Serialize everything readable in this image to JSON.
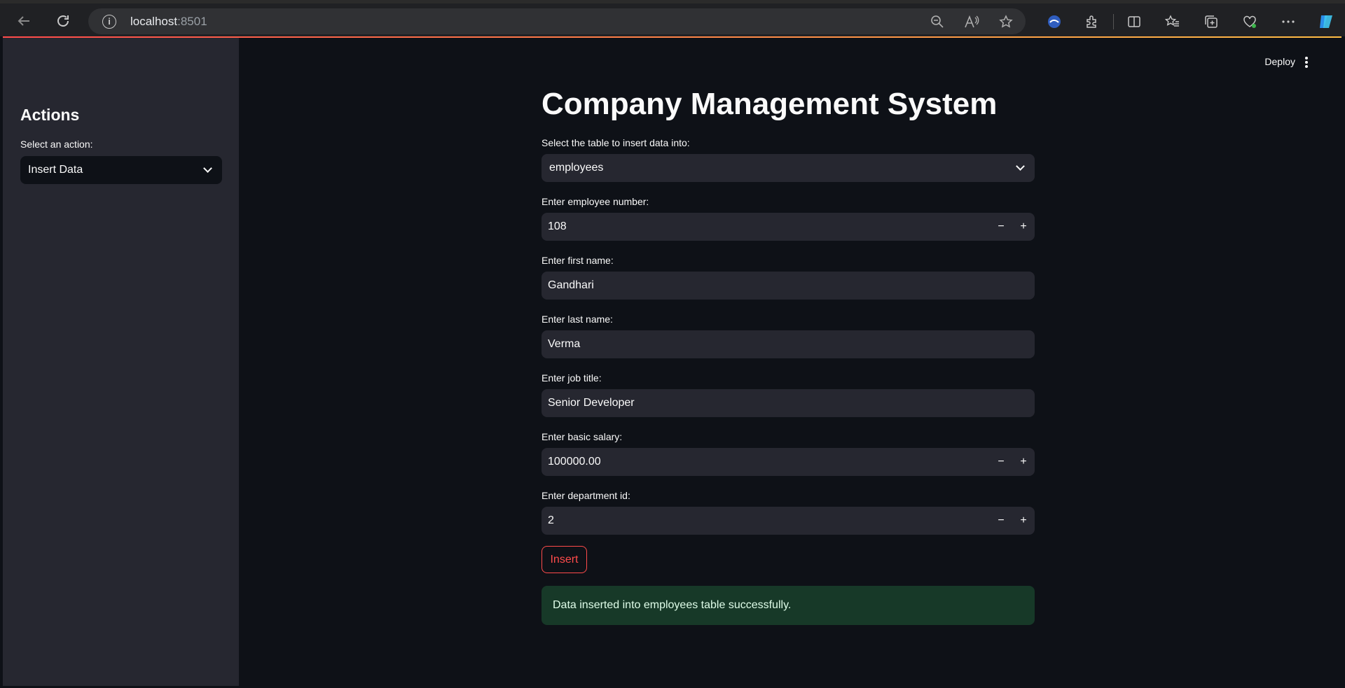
{
  "browser": {
    "url_host": "localhost",
    "url_port": ":8501"
  },
  "sidebar": {
    "heading": "Actions",
    "action_label": "Select an action:",
    "action_value": "Insert Data"
  },
  "header": {
    "deploy_label": "Deploy"
  },
  "main": {
    "title": "Company Management System",
    "table_select": {
      "label": "Select the table to insert data into:",
      "value": "employees"
    },
    "fields": {
      "employee_number": {
        "label": "Enter employee number:",
        "value": "108"
      },
      "first_name": {
        "label": "Enter first name:",
        "value": "Gandhari"
      },
      "last_name": {
        "label": "Enter last name:",
        "value": "Verma"
      },
      "job_title": {
        "label": "Enter job title:",
        "value": "Senior Developer"
      },
      "basic_salary": {
        "label": "Enter basic salary:",
        "value": "100000.00"
      },
      "department_id": {
        "label": "Enter department id:",
        "value": "2"
      }
    },
    "stepper": {
      "minus": "−",
      "plus": "+"
    },
    "insert_label": "Insert",
    "success_message": "Data inserted into employees table successfully."
  },
  "colors": {
    "accent": "#ff4b4b",
    "background": "#0e1117",
    "sidebar": "#262730",
    "success_bg": "#173928"
  }
}
